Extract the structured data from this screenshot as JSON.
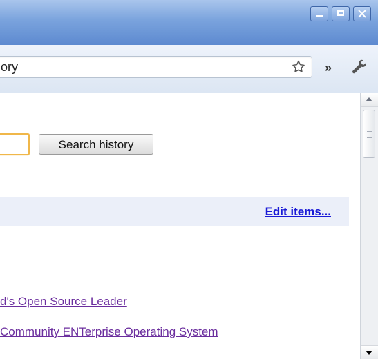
{
  "browser": {
    "window_controls": {
      "minimize_icon": "minimize-icon",
      "maximize_icon": "maximize-icon",
      "close_icon": "close-icon"
    },
    "toolbar": {
      "address_text": "ory",
      "bookmark_icon": "star-icon",
      "overflow_label": "»",
      "settings_icon": "wrench-icon"
    }
  },
  "history": {
    "search_input": {
      "value": ""
    },
    "search_button_label": "Search history",
    "edit_items_label": "Edit items...",
    "entries": [
      "d's Open Source Leader",
      " Community ENTerprise Operating System"
    ]
  },
  "colors": {
    "titlebar": "#7aa3dd",
    "link_visited": "#6b2e9e",
    "link_action": "#1a1ad6",
    "focus_ring": "#f0b74a",
    "edit_bar": "#ebeff9"
  }
}
